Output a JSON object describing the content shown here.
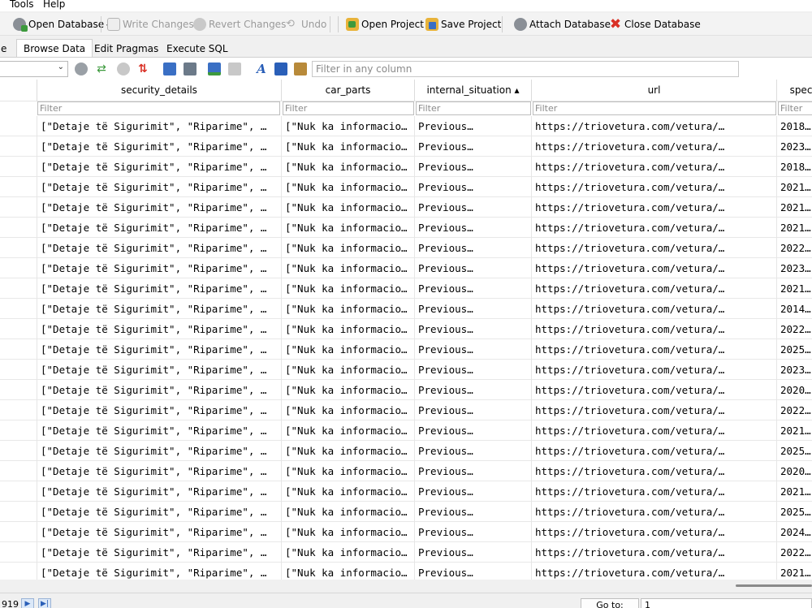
{
  "menu": {
    "tools": "Tools",
    "help": "Help"
  },
  "toolbar": {
    "open_database": "Open Database",
    "write_changes": "Write Changes",
    "revert_changes": "Revert Changes",
    "undo": "Undo",
    "open_project": "Open Project",
    "save_project": "Save Project",
    "attach_database": "Attach Database",
    "close_database": "Close Database"
  },
  "tabs": {
    "partial": "e",
    "browse_data": "Browse Data",
    "edit_pragmas": "Edit Pragmas",
    "execute_sql": "Execute SQL"
  },
  "filter_any": {
    "placeholder": "Filter in any column"
  },
  "columns": {
    "security_details": "security_details",
    "car_parts": "car_parts",
    "internal_situation": "internal_situation ▴",
    "url": "url",
    "spec": "spec"
  },
  "filter_placeholder": "Filter",
  "cell_text": {
    "security": "[\"Detaje të Sigurimit\", \"Riparime\", …",
    "parts": "[\"Nuk ka informacio…",
    "internal": "Previous…",
    "url": "https://triovetura.com/vetura/…"
  },
  "rows": [
    {
      "spec": "2018…"
    },
    {
      "spec": "2023…"
    },
    {
      "spec": "2018…"
    },
    {
      "spec": "2021…"
    },
    {
      "spec": "2021…"
    },
    {
      "spec": "2021…"
    },
    {
      "spec": "2022…"
    },
    {
      "spec": "2023…"
    },
    {
      "spec": "2021…"
    },
    {
      "spec": "2014…"
    },
    {
      "spec": "2022…"
    },
    {
      "spec": "2025…"
    },
    {
      "spec": "2023…"
    },
    {
      "spec": "2020…"
    },
    {
      "spec": "2022…"
    },
    {
      "spec": "2021…"
    },
    {
      "spec": "2025…"
    },
    {
      "spec": "2020…"
    },
    {
      "spec": "2021…"
    },
    {
      "spec": "2025…"
    },
    {
      "spec": "2024…"
    },
    {
      "spec": "2022…"
    },
    {
      "spec": "2021…"
    }
  ],
  "status": {
    "count_partial": "919",
    "goto_label": "Go to:",
    "goto_value": "1"
  },
  "colors": {
    "accent_blue": "#2a5fb8",
    "close_red": "#d93025",
    "green_icon": "#3d9a3d"
  }
}
